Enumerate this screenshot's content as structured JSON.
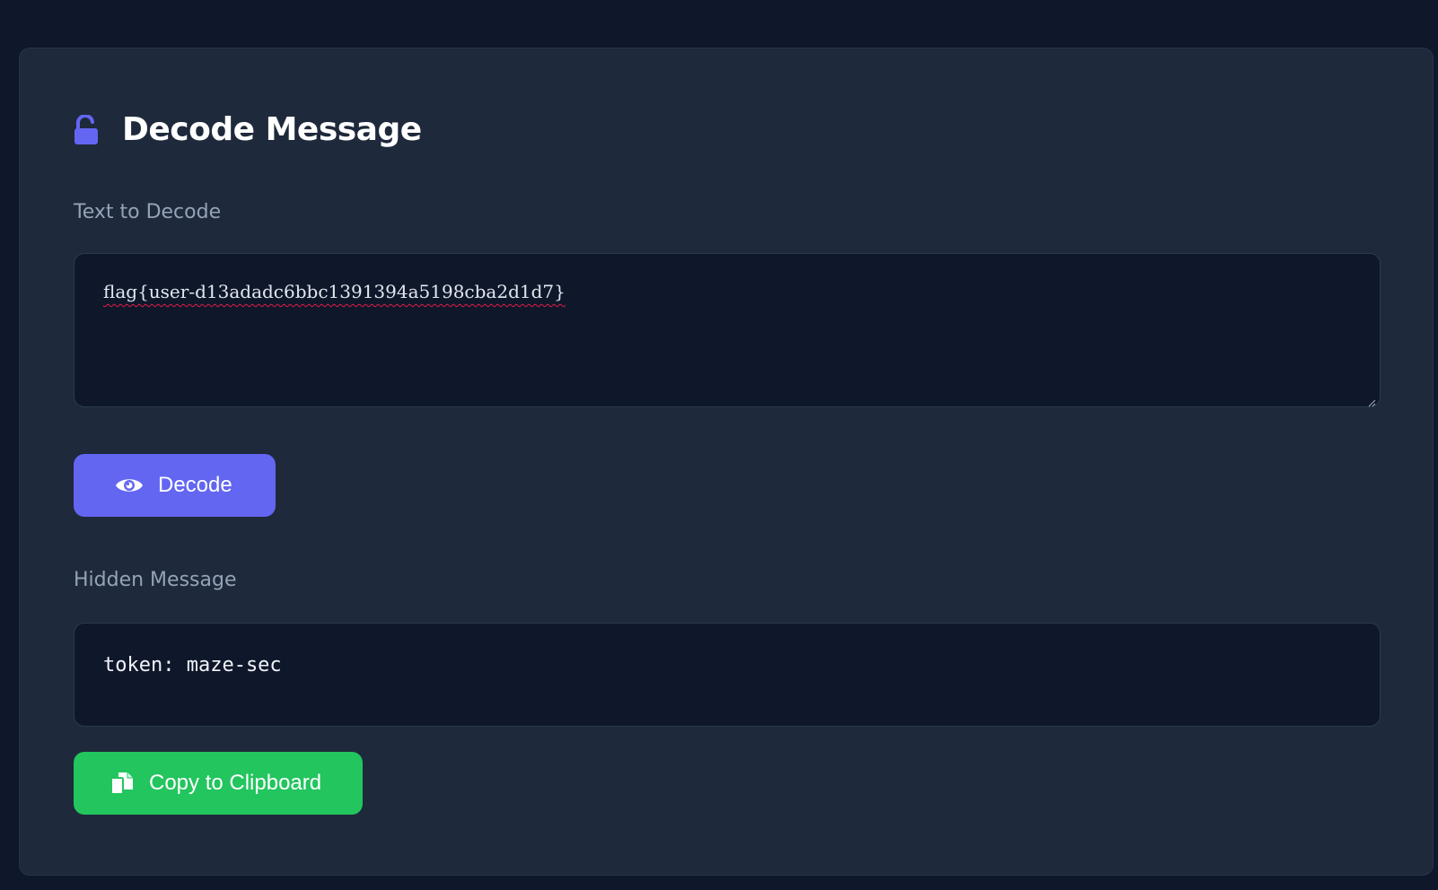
{
  "header": {
    "title": "Decode Message",
    "icon": "unlock-icon",
    "accent": "#6366f1"
  },
  "input": {
    "label": "Text to Decode",
    "value": "flag{user-d13adadc6bbc1391394a5198cba2d1d7}"
  },
  "decode_button": {
    "label": "Decode",
    "icon": "eye-icon",
    "color": "#6366f1"
  },
  "output": {
    "label": "Hidden Message",
    "value": "token: maze-sec"
  },
  "copy_button": {
    "label": "Copy to Clipboard",
    "icon": "copy-icon",
    "color": "#22c55e"
  }
}
